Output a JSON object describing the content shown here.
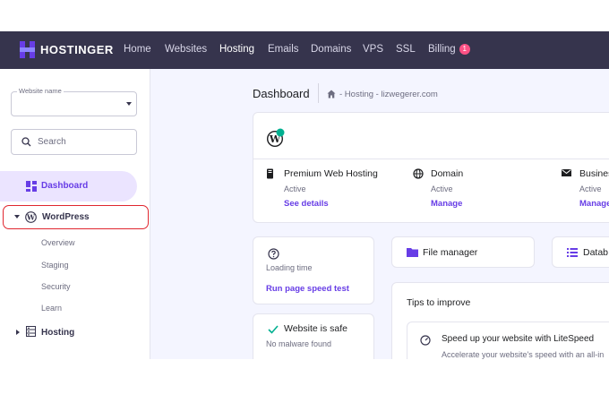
{
  "topnav": {
    "brand": "HOSTINGER",
    "items": [
      {
        "label": "Home"
      },
      {
        "label": "Websites"
      },
      {
        "label": "Hosting"
      },
      {
        "label": "Emails"
      },
      {
        "label": "Domains"
      },
      {
        "label": "VPS"
      },
      {
        "label": "SSL"
      },
      {
        "label": "Billing"
      }
    ],
    "active": "Hosting",
    "billing_badge": "1"
  },
  "sidebar": {
    "website_select": {
      "label": "Website name",
      "value": ""
    },
    "search": {
      "placeholder": "Search"
    },
    "dashboard": "Dashboard",
    "wordpress": {
      "label": "WordPress",
      "children": [
        "Overview",
        "Staging",
        "Security",
        "Learn"
      ]
    },
    "hosting": "Hosting"
  },
  "main": {
    "title": "Dashboard",
    "breadcrumb": "- Hosting - lizwegerer.com",
    "overview": {
      "plans": [
        {
          "title": "Premium Web Hosting",
          "status": "Active",
          "link": "See details",
          "icon": "server-icon"
        },
        {
          "title": "Domain",
          "status": "Active",
          "link": "Manage",
          "icon": "globe-icon"
        },
        {
          "title": "Business",
          "status": "Active",
          "link": "Manage",
          "icon": "mail-icon"
        }
      ]
    },
    "speed_card": {
      "label": "Loading time",
      "link": "Run page speed test"
    },
    "safe_card": {
      "title": "Website is safe",
      "subtitle": "No malware found"
    },
    "file_manager": "File manager",
    "databases": "Datab",
    "tips": {
      "heading": "Tips to improve",
      "item_title": "Speed up your website with LiteSpeed",
      "item_desc": "Accelerate your website's speed with an all-in"
    }
  },
  "colors": {
    "nav_bg": "#36344d",
    "accent": "#673de6",
    "highlight_border": "#e0262f",
    "page_bg": "#f4f5ff"
  }
}
